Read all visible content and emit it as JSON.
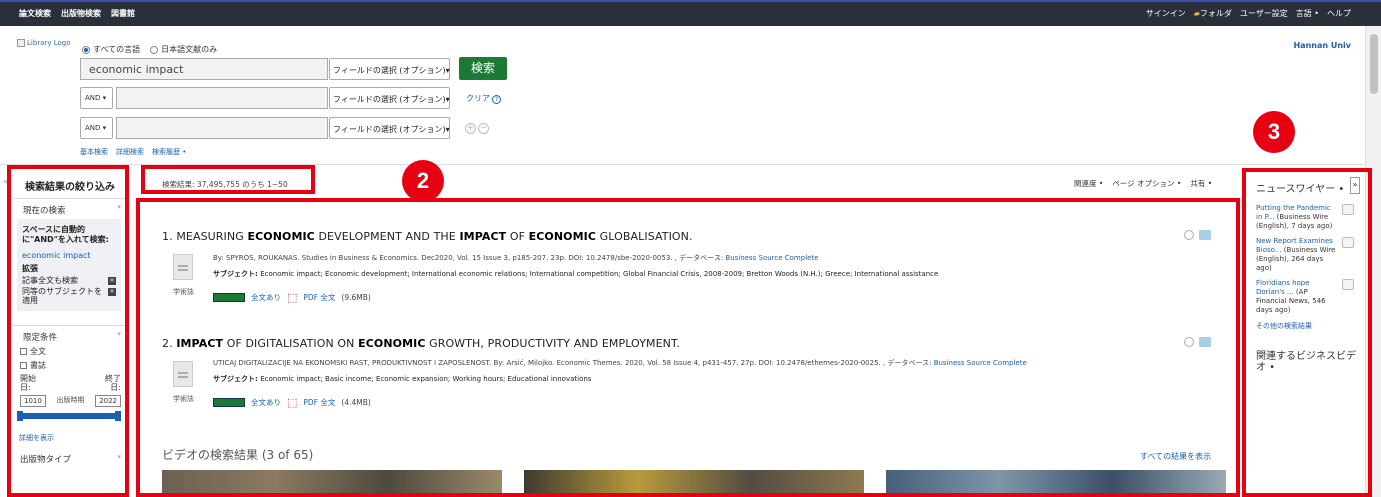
{
  "topnav": {
    "left": [
      "論文検索",
      "出版物検索",
      "図書館"
    ],
    "right": [
      "サインイン",
      "フォルダ",
      "ユーザー設定",
      "言語 •",
      "ヘルプ"
    ]
  },
  "logo_alt": "Library Logo",
  "institution": "Hannan Univ",
  "language_options": [
    "すべての言語",
    "日本語文献のみ"
  ],
  "search": {
    "rows": [
      {
        "op": "",
        "value": "economic impact",
        "field": "フィールドの選択 (オプション)"
      },
      {
        "op": "AND",
        "value": "",
        "field": "フィールドの選択 (オプション)"
      },
      {
        "op": "AND",
        "value": "",
        "field": "フィールドの選択 (オプション)"
      }
    ],
    "search_button": "検索",
    "clear_label": "クリア",
    "links": [
      "基本検索",
      "詳細検索",
      "検索履歴 •"
    ]
  },
  "sidebar": {
    "title": "検索結果の絞り込み",
    "current_search_label": "現在の検索",
    "and_note": "スペースに自動的に\"AND\"を入れて検索:",
    "query": "economic impact",
    "expand_label": "拡張",
    "expanders": [
      "記事全文も検索",
      "同等のサブジェクトを適用"
    ],
    "limit_label": "限定条件",
    "limits": [
      "全文",
      "書誌"
    ],
    "start_label": "開始日:",
    "end_label": "終了日:",
    "start_year": "1010",
    "end_year": "2022",
    "pub_date_label": "出版時期",
    "show_more": "詳細を表示",
    "pub_type_label": "出版物タイプ"
  },
  "results": {
    "count_text": "検索結果: 37,495,755 のうち 1~50",
    "tools": [
      "関連度 •",
      "ページ オプション •",
      "共有 •"
    ],
    "items": [
      {
        "num": "1.",
        "title_parts": [
          [
            "MEASURING ",
            false
          ],
          [
            "ECONOMIC",
            true
          ],
          [
            " DEVELOPMENT AND THE ",
            false
          ],
          [
            "IMPACT",
            true
          ],
          [
            " OF ",
            false
          ],
          [
            "ECONOMIC",
            true
          ],
          [
            " GLOBALISATION.",
            false
          ]
        ],
        "meta": "By: SPYROS, ROUKANAS. Studies in Business & Economics. Dec2020, Vol. 15 Issue 3, p185-207. 23p. DOI: 10.2478/sbe-2020-0053. , データベース: ",
        "db": "Business Source Complete",
        "subject_label": "サブジェクト: ",
        "subjects": "Economic impact; Economic development; International economic relations; International competition; Global Financial Crisis, 2008-2009; Bretton Woods (N.H.); Greece; International assistance",
        "type": "学術誌",
        "full_text": "全文あり",
        "pdf": "PDF 全文",
        "size": "(9.6MB)"
      },
      {
        "num": "2.",
        "title_parts": [
          [
            "IMPACT",
            true
          ],
          [
            " OF DIGITALISATION ON ",
            false
          ],
          [
            "ECONOMIC",
            true
          ],
          [
            " GROWTH, PRODUCTIVITY AND EMPLOYMENT.",
            false
          ]
        ],
        "meta": "UTICAJ DIGITALIZACIJE NA EKONOMSKI RAST, PRODUKTIVNOST I ZAPOSLENOST. By: Arsić, Milojko. Economic Themes. 2020, Vol. 58 Issue 4, p431-457. 27p. DOI: 10.2478/ethemes-2020-0025. , データベース: ",
        "db": "Business Source Complete",
        "subject_label": "サブジェクト: ",
        "subjects": "Economic impact; Basic income; Economic expansion; Working hours; Educational innovations",
        "type": "学術誌",
        "full_text": "全文あり",
        "pdf": "PDF 全文",
        "size": "(4.4MB)"
      }
    ],
    "video_heading": "ビデオの検索結果 (3 of 65)",
    "show_all": "すべての結果を表示"
  },
  "right_panel": {
    "title": "ニュースワイヤー •",
    "news": [
      {
        "link": "Putting the Pandemic in P...",
        "src": " (Business Wire (English), 7 days ago)"
      },
      {
        "link": "New Report Examines Bioso...",
        "src": " (Business Wire (English), 264 days ago)"
      },
      {
        "link": "Floridians hope Dorian's ...",
        "src": " (AP Financial News, 546 days ago)"
      }
    ],
    "other_results": "その他の検索結果",
    "related_video": "関連するビジネスビデオ •"
  },
  "annotations": [
    "2",
    "3"
  ],
  "colors": {
    "annotation": "#e60012",
    "search_button": "#1d7a36",
    "link": "#1a5fb4"
  }
}
